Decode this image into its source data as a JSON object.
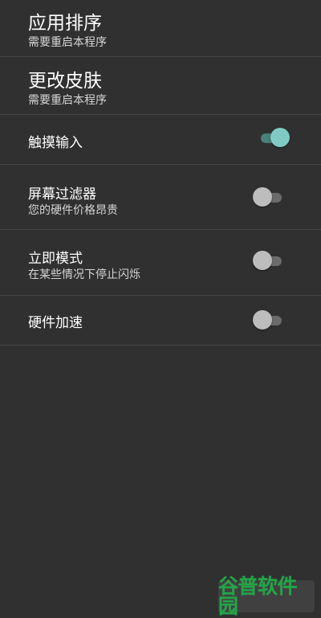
{
  "settings": {
    "items": [
      {
        "title": "应用排序",
        "subtitle": "需要重启本程序"
      },
      {
        "title": "更改皮肤",
        "subtitle": "需要重启本程序"
      },
      {
        "title": "触摸输入",
        "toggle_on": true
      },
      {
        "title": "屏幕过滤器",
        "subtitle": "您的硬件价格昂贵",
        "toggle_on": false
      },
      {
        "title": "立即模式",
        "subtitle": "在某些情况下停止闪烁",
        "toggle_on": false
      },
      {
        "title": "硬件加速",
        "toggle_on": false
      }
    ]
  },
  "watermark": {
    "text": "谷普软件园"
  },
  "colors": {
    "background": "#303030",
    "divider": "#454545",
    "toggle_on_thumb": "#7fcac2",
    "toggle_on_track": "#4a7f7a",
    "toggle_off_thumb": "#bdbdbd",
    "toggle_off_track": "#6b6b6b",
    "watermark": "#20a646"
  }
}
